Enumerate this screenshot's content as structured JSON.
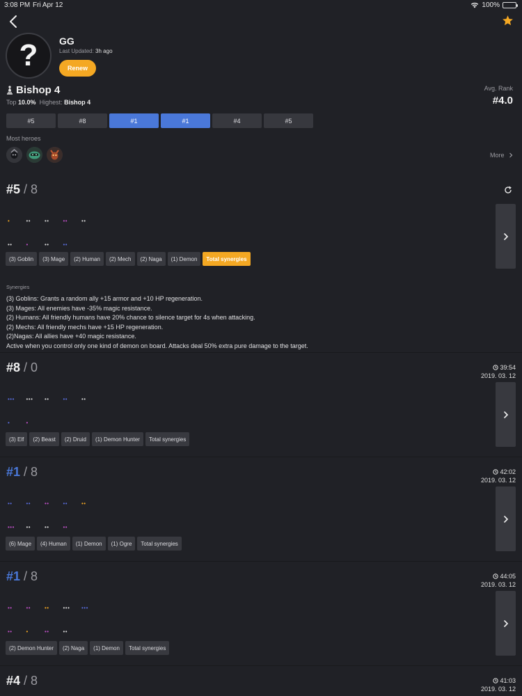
{
  "status_bar": {
    "time": "3:08 PM",
    "date": "Fri Apr 12",
    "battery": "100%"
  },
  "profile": {
    "avatar_glyph": "?",
    "name": "GG",
    "updated_label": "Last Updated:",
    "updated_value": "3h ago",
    "renew_label": "Renew"
  },
  "rank": {
    "title": "Bishop 4",
    "top_label": "Top",
    "top_value": "10.0%",
    "highest_label": "Highest:",
    "highest_value": "Bishop 4",
    "avg_label": "Avg. Rank",
    "avg_value": "#4.0"
  },
  "recent_ranks": [
    {
      "label": "#5",
      "highlight": false
    },
    {
      "label": "#8",
      "highlight": false
    },
    {
      "label": "#1",
      "highlight": true
    },
    {
      "label": "#1",
      "highlight": true
    },
    {
      "label": "#4",
      "highlight": false
    },
    {
      "label": "#5",
      "highlight": false
    }
  ],
  "most_heroes": {
    "label": "Most heroes",
    "more_label": "More",
    "heroes": [
      "hero-1-icon",
      "hero-2-icon",
      "hero-3-icon"
    ]
  },
  "colors": {
    "accent_orange": "#f4a823",
    "accent_blue": "#4a78d9",
    "background": "#202126",
    "card": "#38393f"
  },
  "matches": [
    {
      "rank": "#5",
      "total": "8",
      "first_place": false,
      "time": "",
      "date": "",
      "dots_top": [
        {
          "text": "•",
          "color": "#f4a823"
        },
        {
          "text": "••",
          "color": "#d8d8d8"
        },
        {
          "text": "••",
          "color": "#d8d8d8"
        },
        {
          "text": "••",
          "color": "#c050c8"
        },
        {
          "text": "••",
          "color": "#d8d8d8"
        }
      ],
      "dots_bottom": [
        {
          "text": "••",
          "color": "#d8d8d8"
        },
        {
          "text": "•",
          "color": "#c050c8"
        },
        {
          "text": "••",
          "color": "#d8d8d8"
        },
        {
          "text": "••",
          "color": "#5a6ee0"
        }
      ],
      "synergies": [
        {
          "label": "(3) Goblin",
          "active": false
        },
        {
          "label": "(3) Mage",
          "active": false
        },
        {
          "label": "(2) Human",
          "active": false
        },
        {
          "label": "(2) Mech",
          "active": false
        },
        {
          "label": "(2) Naga",
          "active": false
        },
        {
          "label": "(1) Demon",
          "active": false
        },
        {
          "label": "Total synergies",
          "active": true
        }
      ],
      "synergy_title": "Synergies",
      "synergy_details": [
        "(3) Goblins: Grants a random ally +15 armor and +10 HP regeneration.",
        "(3) Mages: All enemies have -35% magic resistance.",
        "(2) Humans: All friendly humans have 20% chance to silence target for 4s when attacking.",
        "(2) Mechs: All friendly mechs have +15 HP regeneration.",
        "(2)Nagas: All allies have +40 magic resistance.",
        "Active when you control only one kind of demon on board. Attacks deal 50% extra pure damage to the target."
      ]
    },
    {
      "rank": "#8",
      "total": "0",
      "first_place": false,
      "time": "39:54",
      "date": "2019. 03. 12",
      "dots_top": [
        {
          "text": "•••",
          "color": "#5a6ee0"
        },
        {
          "text": "•••",
          "color": "#d8d8d8"
        },
        {
          "text": "••",
          "color": "#d8d8d8"
        },
        {
          "text": "••",
          "color": "#5a6ee0"
        },
        {
          "text": "••",
          "color": "#d8d8d8"
        }
      ],
      "dots_bottom": [
        {
          "text": "•",
          "color": "#5a6ee0"
        },
        {
          "text": "•",
          "color": "#c050c8"
        }
      ],
      "synergies": [
        {
          "label": "(3) Elf",
          "active": false
        },
        {
          "label": "(2) Beast",
          "active": false
        },
        {
          "label": "(2) Druid",
          "active": false
        },
        {
          "label": "(1) Demon Hunter",
          "active": false
        },
        {
          "label": "Total synergies",
          "active": false
        }
      ]
    },
    {
      "rank": "#1",
      "total": "8",
      "first_place": true,
      "time": "42:02",
      "date": "2019. 03. 12",
      "dots_top": [
        {
          "text": "••",
          "color": "#5a6ee0"
        },
        {
          "text": "••",
          "color": "#5a6ee0"
        },
        {
          "text": "••",
          "color": "#c050c8"
        },
        {
          "text": "••",
          "color": "#5a6ee0"
        },
        {
          "text": "••",
          "color": "#f4a823"
        }
      ],
      "dots_bottom": [
        {
          "text": "•••",
          "color": "#c050c8"
        },
        {
          "text": "••",
          "color": "#d8d8d8"
        },
        {
          "text": "••",
          "color": "#d8d8d8"
        },
        {
          "text": "••",
          "color": "#c050c8"
        }
      ],
      "synergies": [
        {
          "label": "(6) Mage",
          "active": false
        },
        {
          "label": "(4) Human",
          "active": false
        },
        {
          "label": "(1) Demon",
          "active": false
        },
        {
          "label": "(1) Ogre",
          "active": false
        },
        {
          "label": "Total synergies",
          "active": false
        }
      ]
    },
    {
      "rank": "#1",
      "total": "8",
      "first_place": true,
      "time": "44:05",
      "date": "2019. 03. 12",
      "dots_top": [
        {
          "text": "••",
          "color": "#c050c8"
        },
        {
          "text": "••",
          "color": "#c050c8"
        },
        {
          "text": "••",
          "color": "#f4a823"
        },
        {
          "text": "•••",
          "color": "#d8d8d8"
        },
        {
          "text": "•••",
          "color": "#5a6ee0"
        }
      ],
      "dots_bottom": [
        {
          "text": "••",
          "color": "#c050c8"
        },
        {
          "text": "•",
          "color": "#f4a823"
        },
        {
          "text": "••",
          "color": "#c050c8"
        },
        {
          "text": "••",
          "color": "#d8d8d8"
        }
      ],
      "synergies": [
        {
          "label": "(2) Demon Hunter",
          "active": false
        },
        {
          "label": "(2) Naga",
          "active": false
        },
        {
          "label": "(1) Demon",
          "active": false
        },
        {
          "label": "Total synergies",
          "active": false
        }
      ]
    },
    {
      "rank": "#4",
      "total": "8",
      "first_place": false,
      "time": "41:03",
      "date": "2019. 03. 12",
      "dots_top": [],
      "dots_bottom": [],
      "synergies": []
    }
  ]
}
